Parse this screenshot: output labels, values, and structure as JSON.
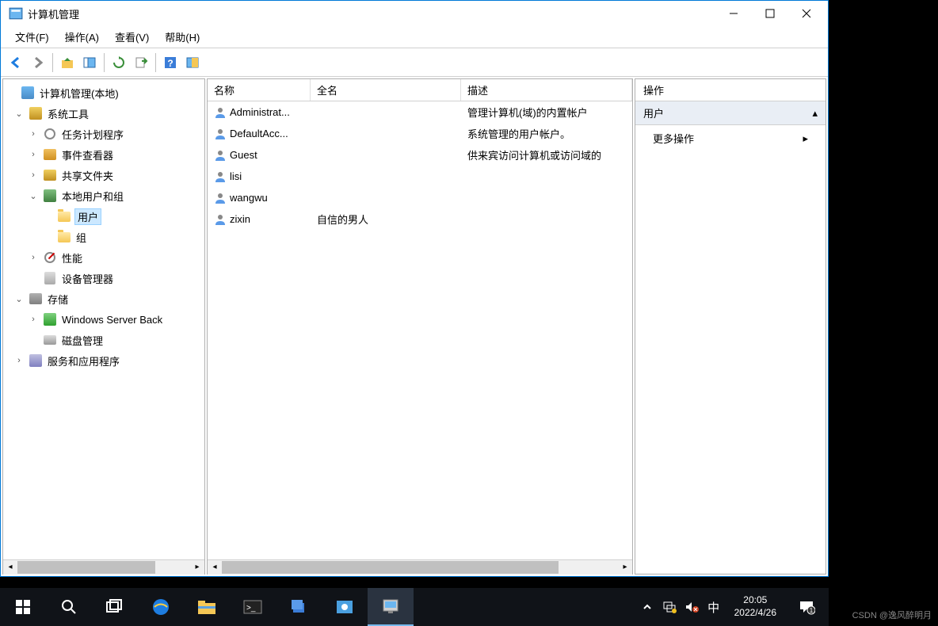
{
  "window": {
    "title": "计算机管理"
  },
  "menubar": {
    "file": "文件(F)",
    "action": "操作(A)",
    "view": "查看(V)",
    "help": "帮助(H)"
  },
  "tree": {
    "root": "计算机管理(本地)",
    "system_tools": "系统工具",
    "task_scheduler": "任务计划程序",
    "event_viewer": "事件查看器",
    "shared_folders": "共享文件夹",
    "local_users_groups": "本地用户和组",
    "users": "用户",
    "groups": "组",
    "performance": "性能",
    "device_manager": "设备管理器",
    "storage": "存储",
    "windows_server_backup": "Windows Server Back",
    "disk_management": "磁盘管理",
    "services_apps": "服务和应用程序"
  },
  "list": {
    "headers": {
      "name": "名称",
      "fullname": "全名",
      "description": "描述"
    },
    "rows": [
      {
        "name": "Administrat...",
        "fullname": "",
        "description": "管理计算机(域)的内置帐户"
      },
      {
        "name": "DefaultAcc...",
        "fullname": "",
        "description": "系统管理的用户帐户。"
      },
      {
        "name": "Guest",
        "fullname": "",
        "description": "供来宾访问计算机或访问域的"
      },
      {
        "name": "lisi",
        "fullname": "",
        "description": ""
      },
      {
        "name": "wangwu",
        "fullname": "",
        "description": ""
      },
      {
        "name": "zixin",
        "fullname": "自信的男人",
        "description": ""
      }
    ]
  },
  "actions": {
    "header": "操作",
    "group": "用户",
    "more": "更多操作"
  },
  "taskbar": {
    "ime": "中",
    "time": "20:05",
    "date": "2022/4/26"
  },
  "watermark": "CSDN @逸风醉明月"
}
